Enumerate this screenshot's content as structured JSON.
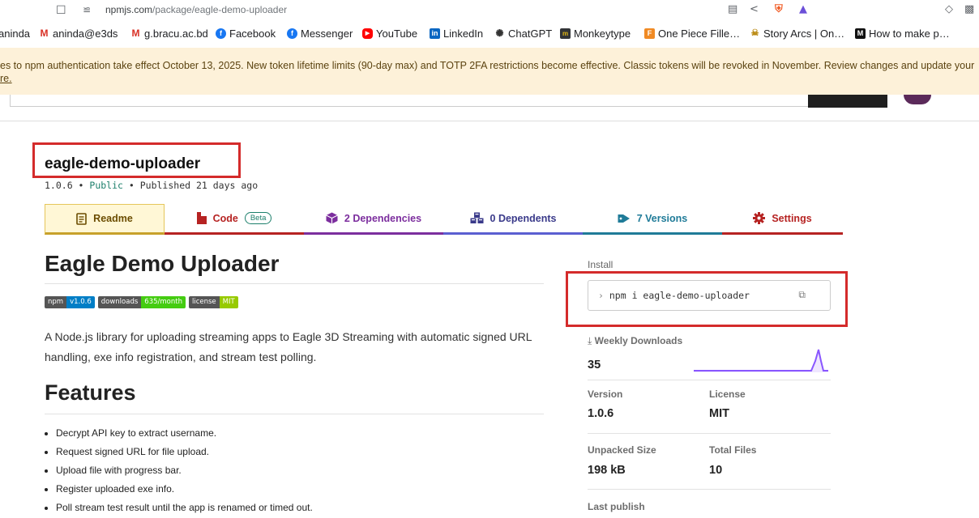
{
  "browser": {
    "url_domain": "npmjs.com",
    "url_path": "/package/eagle-demo-uploader",
    "bookmarks": [
      {
        "label": "aninda",
        "icon": "person-icon"
      },
      {
        "label": "aninda@e3ds",
        "icon": "gmail-icon"
      },
      {
        "label": "g.bracu.ac.bd",
        "icon": "gmail-icon"
      },
      {
        "label": "Facebook",
        "icon": "facebook-icon"
      },
      {
        "label": "Messenger",
        "icon": "messenger-icon"
      },
      {
        "label": "YouTube",
        "icon": "youtube-icon"
      },
      {
        "label": "LinkedIn",
        "icon": "linkedin-icon"
      },
      {
        "label": "ChatGPT",
        "icon": "chatgpt-icon"
      },
      {
        "label": "Monkeytype",
        "icon": "monkeytype-icon"
      },
      {
        "label": "One Piece Fille…",
        "icon": "onepiece-icon"
      },
      {
        "label": "Story Arcs | On…",
        "icon": "story-arcs-icon"
      },
      {
        "label": "How to make p…",
        "icon": "medium-icon"
      }
    ]
  },
  "banner": {
    "line1": "es to npm authentication take effect October 13, 2025. New token lifetime limits (90-day max) and TOTP 2FA restrictions become effective. Classic tokens will be revoked in November. Review changes and update your",
    "line2": "re."
  },
  "package": {
    "name": "eagle-demo-uploader",
    "version": "1.0.6",
    "visibility": "Public",
    "published": "Published 21 days ago"
  },
  "tabs": {
    "readme": "Readme",
    "code": "Code",
    "beta": "Beta",
    "dependencies": "2 Dependencies",
    "dependents": "0 Dependents",
    "versions": "7 Versions",
    "settings": "Settings"
  },
  "readme": {
    "title": "Eagle Demo Uploader",
    "badges": [
      {
        "key": "npm",
        "value": "v1.0.6",
        "color": "#007ec6"
      },
      {
        "key": "downloads",
        "value": "635/month",
        "color": "#4c1"
      },
      {
        "key": "license",
        "value": "MIT",
        "color": "#97ca00"
      }
    ],
    "description": "A Node.js library for uploading streaming apps to Eagle 3D Streaming with automatic signed URL handling, exe info registration, and stream test polling.",
    "features_title": "Features",
    "features": [
      "Decrypt API key to extract username.",
      "Request signed URL for file upload.",
      "Upload file with progress bar.",
      "Register uploaded exe info.",
      "Poll stream test result until the app is renamed or timed out."
    ]
  },
  "sidebar": {
    "install_label": "Install",
    "install_cmd": "npm i eagle-demo-uploader",
    "weekly_label": "Weekly Downloads",
    "weekly_value": "35",
    "version_label": "Version",
    "version_value": "1.0.6",
    "license_label": "License",
    "license_value": "MIT",
    "unpacked_label": "Unpacked Size",
    "unpacked_value": "198 kB",
    "files_label": "Total Files",
    "files_value": "10",
    "last_publish_label": "Last publish"
  },
  "colors": {
    "annotation_red": "#d42b2b",
    "sparkline": "#8956ff",
    "banner_bg": "#fdf1d9"
  }
}
